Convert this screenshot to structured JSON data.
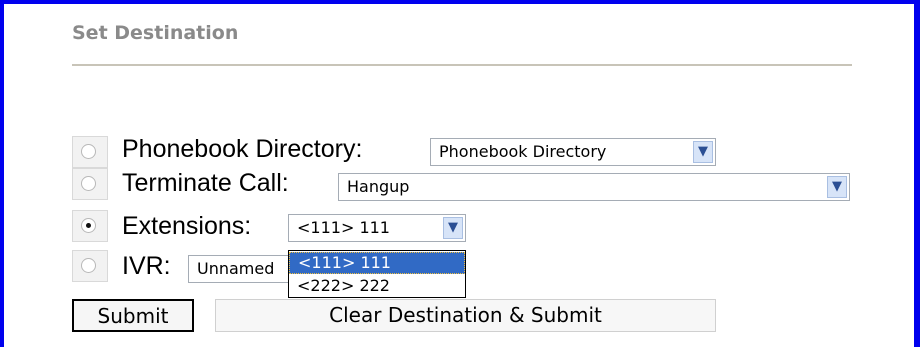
{
  "section": {
    "title": "Set Destination"
  },
  "options": [
    {
      "label": "Phonebook Directory:",
      "selected": false,
      "select_value": "Phonebook Directory"
    },
    {
      "label": "Terminate Call:",
      "selected": false,
      "select_value": "Hangup"
    },
    {
      "label": "Extensions:",
      "selected": true,
      "select_value": "<111> 111"
    },
    {
      "label": "IVR:",
      "selected": false,
      "select_value": "Unnamed"
    }
  ],
  "extensions_dropdown": {
    "open": true,
    "items": [
      {
        "label": "<111> 111",
        "highlighted": true
      },
      {
        "label": "<222> 222",
        "highlighted": false
      }
    ]
  },
  "buttons": {
    "submit": "Submit",
    "clear_submit": "Clear Destination & Submit"
  },
  "colors": {
    "frame": "#0000ee",
    "title": "#8a8a8a",
    "dropdown_highlight": "#316ac5"
  },
  "icons": [
    "radio-icon",
    "chevron-down-icon"
  ]
}
